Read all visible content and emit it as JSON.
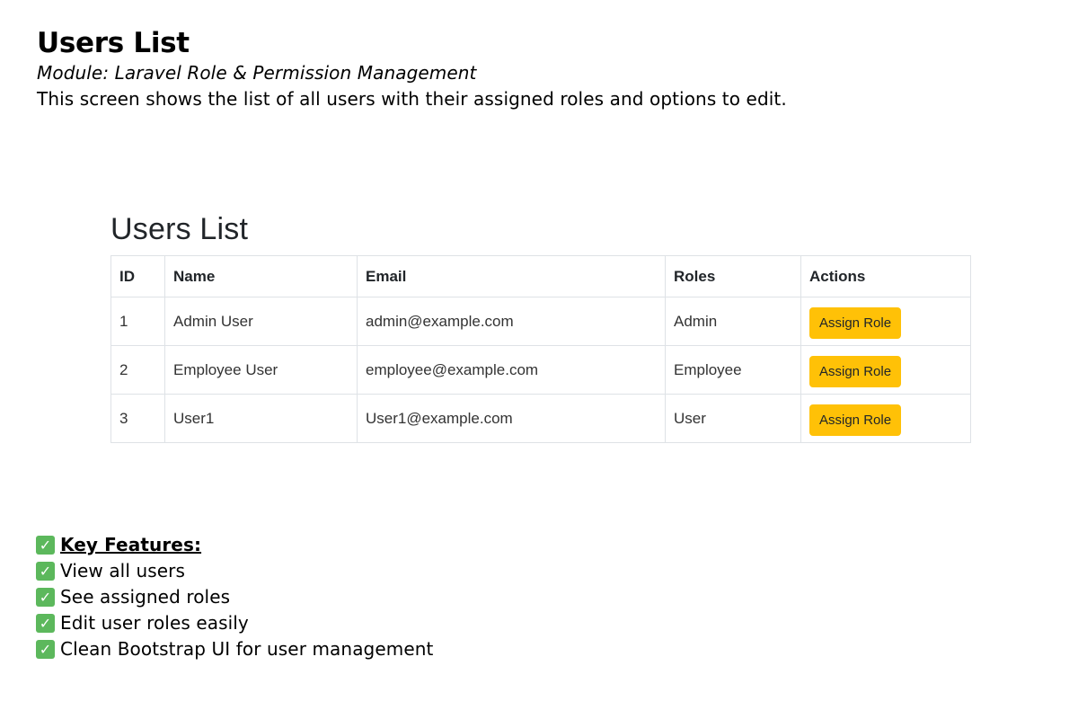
{
  "document": {
    "title": "Users List",
    "module": "Module: Laravel Role & Permission Management",
    "description": "This screen shows the list of all users with their assigned roles and options to edit."
  },
  "screenshot": {
    "title": "Users List",
    "table": {
      "headers": [
        "ID",
        "Name",
        "Email",
        "Roles",
        "Actions"
      ],
      "rows": [
        {
          "id": "1",
          "name": "Admin User",
          "email": "admin@example.com",
          "role": "Admin",
          "action": "Assign Role"
        },
        {
          "id": "2",
          "name": "Employee User",
          "email": "employee@example.com",
          "role": "Employee",
          "action": "Assign Role"
        },
        {
          "id": "3",
          "name": "User1",
          "email": "User1@example.com",
          "role": "User",
          "action": "Assign Role"
        }
      ]
    },
    "colors": {
      "button_bg": "#ffc107",
      "border": "#dee2e6"
    }
  },
  "features": {
    "heading": "Key Features:",
    "items": [
      "View all users",
      "See assigned roles",
      "Edit user roles easily",
      "Clean Bootstrap UI for user management"
    ],
    "icon": "check-mark-icon",
    "icon_color": "#5cb85c"
  }
}
